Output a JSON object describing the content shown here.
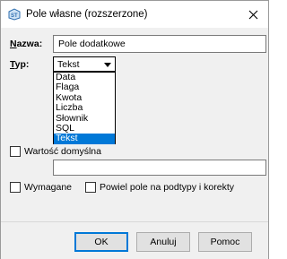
{
  "window": {
    "title": "Pole własne (rozszerzone)"
  },
  "form": {
    "name_label": "Nazwa:",
    "name_value": "Pole dodatkowe",
    "type_label": "Typ:",
    "type_selected": "Tekst",
    "type_options": [
      "Data",
      "Flaga",
      "Kwota",
      "Liczba",
      "Słownik",
      "SQL",
      "Tekst"
    ],
    "default_value_label": "Wartość domyślna",
    "default_value": "",
    "required_label": "Wymagane",
    "repeat_label": "Powiel pole na podtypy i korekty"
  },
  "buttons": {
    "ok": "OK",
    "cancel": "Anuluj",
    "help": "Pomoc"
  },
  "colors": {
    "selection": "#0078d7",
    "dialog_bg": "#f0f0f0"
  }
}
